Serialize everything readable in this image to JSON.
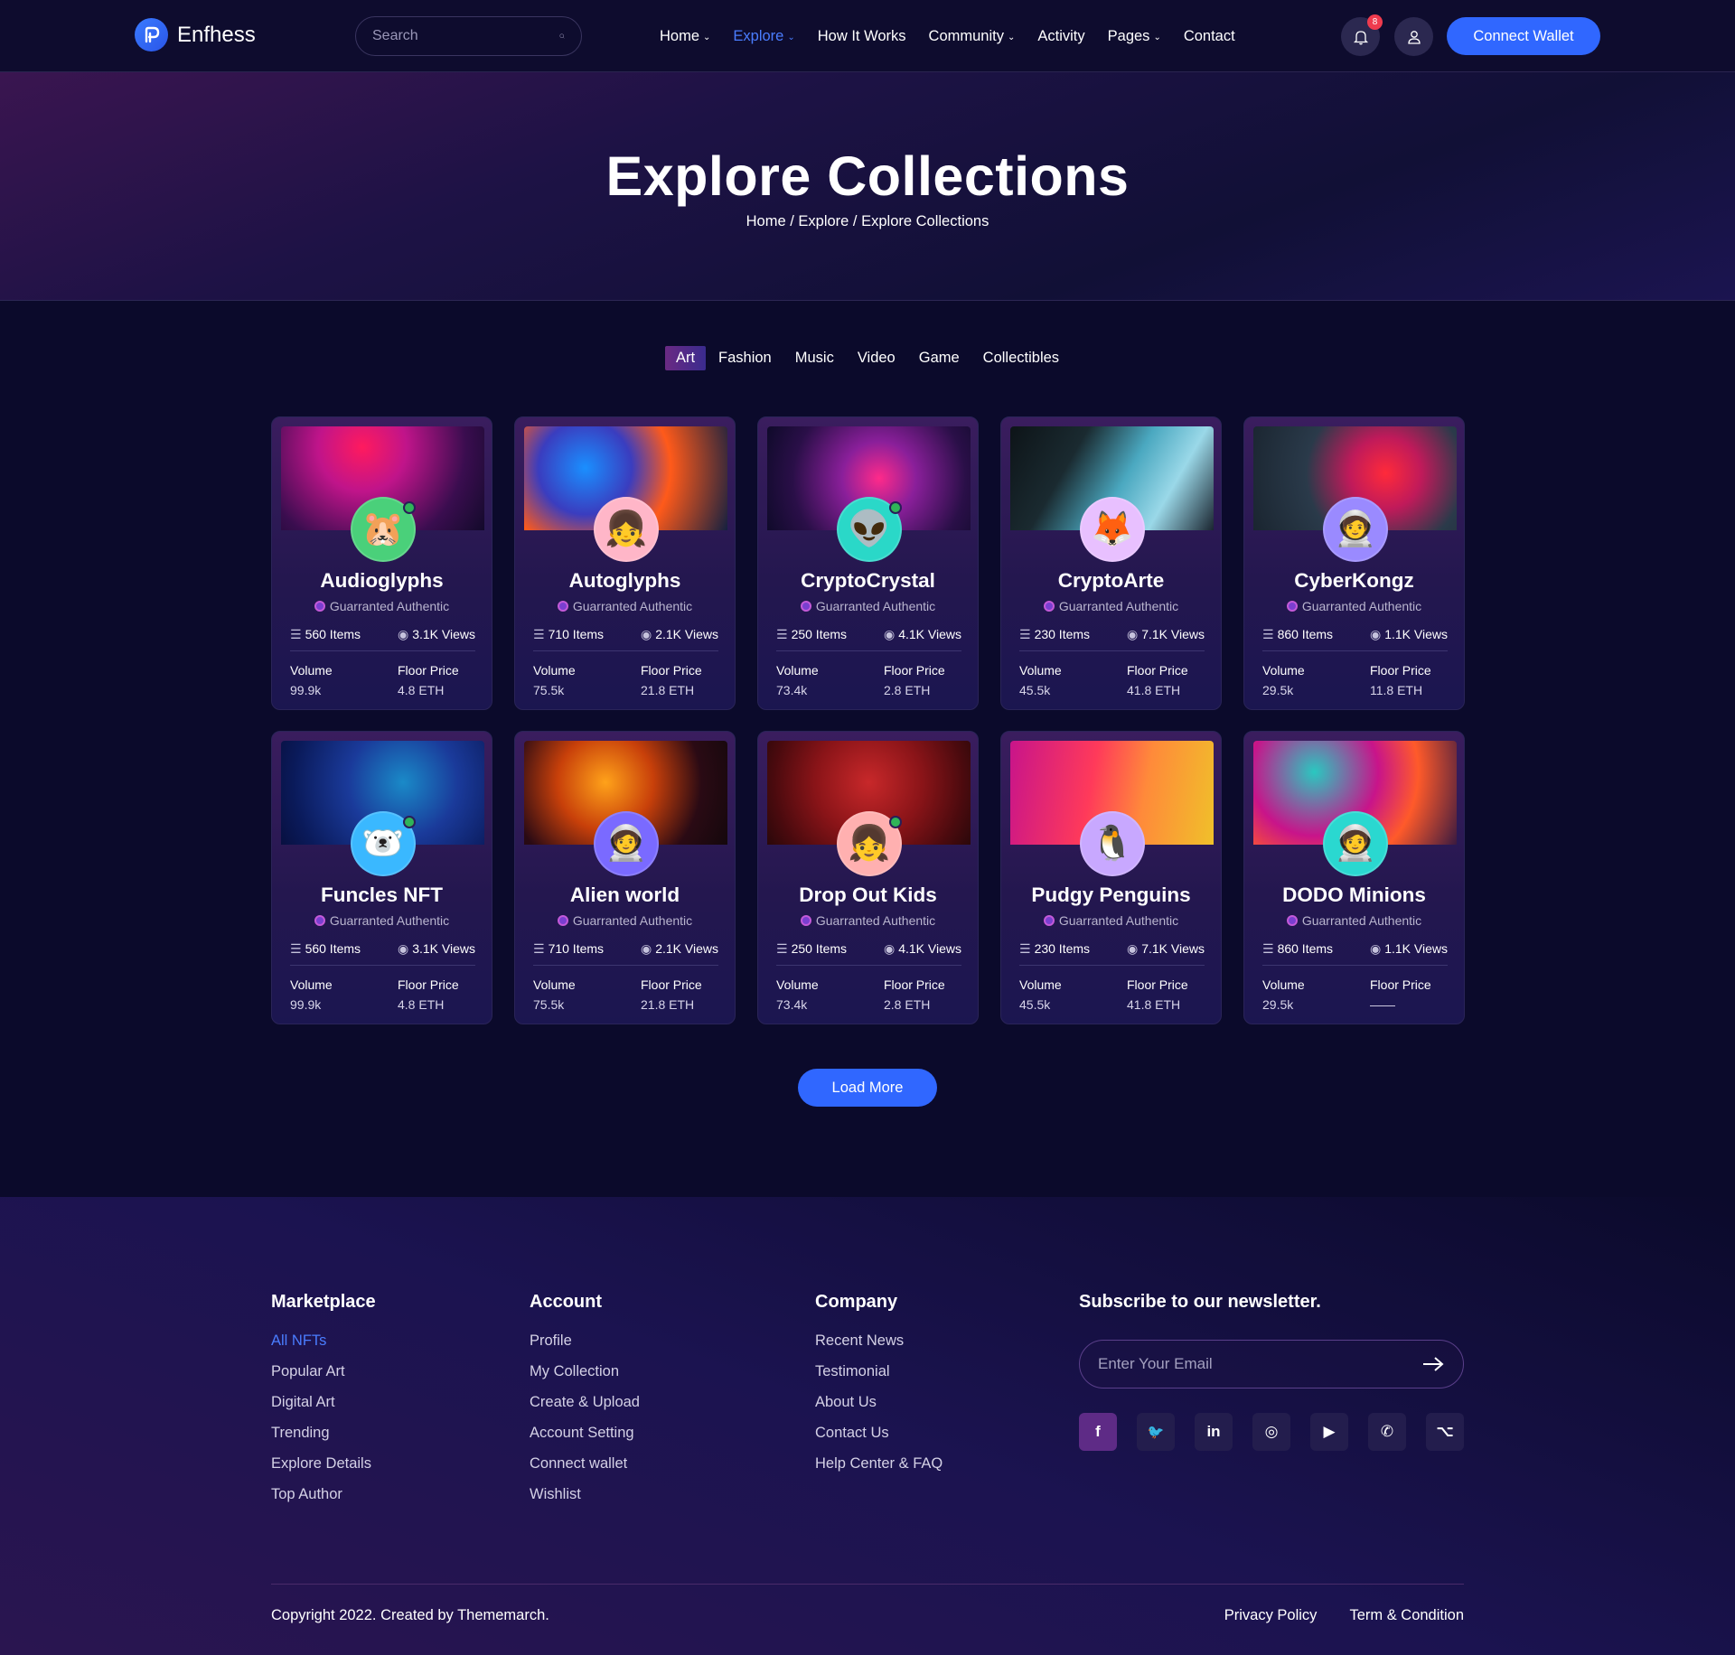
{
  "header": {
    "brand": "Enfhess",
    "search_placeholder": "Search",
    "nav": [
      {
        "label": "Home",
        "dropdown": true,
        "active": false
      },
      {
        "label": "Explore",
        "dropdown": true,
        "active": true
      },
      {
        "label": "How It Works",
        "dropdown": false,
        "active": false
      },
      {
        "label": "Community",
        "dropdown": true,
        "active": false
      },
      {
        "label": "Activity",
        "dropdown": false,
        "active": false
      },
      {
        "label": "Pages",
        "dropdown": true,
        "active": false
      },
      {
        "label": "Contact",
        "dropdown": false,
        "active": false
      }
    ],
    "notification_count": "8",
    "connect_label": "Connect Wallet"
  },
  "hero": {
    "title": "Explore Collections",
    "breadcrumb": "Home / Explore / Explore Collections"
  },
  "tabs": [
    "Art",
    "Fashion",
    "Music",
    "Video",
    "Game",
    "Collectibles"
  ],
  "active_tab": "Art",
  "labels": {
    "authentic": "Guarranted Authentic",
    "volume": "Volume",
    "floor_price": "Floor Price"
  },
  "cards": [
    {
      "title": "Audioglyphs",
      "items": "560 Items",
      "views": "3.1K Views",
      "volume": "99.9k",
      "floor": "4.8 ETH",
      "online": true
    },
    {
      "title": "Autoglyphs",
      "items": "710 Items",
      "views": "2.1K Views",
      "volume": "75.5k",
      "floor": "21.8 ETH",
      "online": false
    },
    {
      "title": "CryptoCrystal",
      "items": "250 Items",
      "views": "4.1K Views",
      "volume": "73.4k",
      "floor": "2.8 ETH",
      "online": true
    },
    {
      "title": "CryptoArte",
      "items": "230 Items",
      "views": "7.1K Views",
      "volume": "45.5k",
      "floor": "41.8 ETH",
      "online": false
    },
    {
      "title": "CyberKongz",
      "items": "860 Items",
      "views": "1.1K Views",
      "volume": "29.5k",
      "floor": "11.8 ETH",
      "online": false
    },
    {
      "title": "Funcles NFT",
      "items": "560 Items",
      "views": "3.1K Views",
      "volume": "99.9k",
      "floor": "4.8 ETH",
      "online": true
    },
    {
      "title": "Alien world",
      "items": "710 Items",
      "views": "2.1K Views",
      "volume": "75.5k",
      "floor": "21.8 ETH",
      "online": false
    },
    {
      "title": "Drop Out Kids",
      "items": "250 Items",
      "views": "4.1K Views",
      "volume": "73.4k",
      "floor": "2.8 ETH",
      "online": true
    },
    {
      "title": "Pudgy Penguins",
      "items": "230 Items",
      "views": "7.1K Views",
      "volume": "45.5k",
      "floor": "41.8 ETH",
      "online": false
    },
    {
      "title": "DODO Minions",
      "items": "860 Items",
      "views": "1.1K Views",
      "volume": "29.5k",
      "floor": "——",
      "online": false
    }
  ],
  "load_more": "Load More",
  "footer": {
    "columns": [
      {
        "title": "Marketplace",
        "links": [
          "All NFTs",
          "Popular Art",
          "Digital Art",
          "Trending",
          "Explore Details",
          "Top Author"
        ],
        "active_index": 0
      },
      {
        "title": "Account",
        "links": [
          "Profile",
          "My Collection",
          "Create & Upload",
          "Account Setting",
          "Connect wallet",
          "Wishlist"
        ],
        "active_index": -1
      },
      {
        "title": "Company",
        "links": [
          "Recent News",
          "Testimonial",
          "About Us",
          "Contact Us",
          "Help Center & FAQ"
        ],
        "active_index": -1
      }
    ],
    "newsletter_title": "Subscribe to our newsletter.",
    "email_placeholder": "Enter Your Email",
    "socials": [
      "facebook-icon",
      "twitter-icon",
      "linkedin-icon",
      "instagram-icon",
      "youtube-icon",
      "whatsapp-icon",
      "github-icon"
    ],
    "copyright": "Copyright 2022. Created by Thememarch.",
    "bottom_links": [
      "Privacy Policy",
      "Term & Condition"
    ]
  },
  "colors": {
    "accent": "#3067ff",
    "active_nav": "#4a7dff",
    "background": "#0b0a2b",
    "badge": "#ef3b4e",
    "online": "#2fb458"
  }
}
